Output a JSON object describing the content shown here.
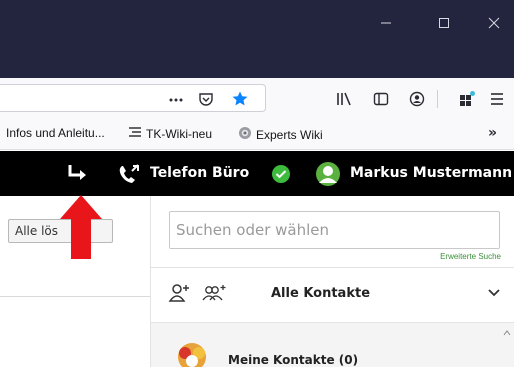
{
  "window": {
    "minimize_label": "—",
    "maximize_label": "□",
    "close_label": "✕"
  },
  "navbar": {
    "url_actions": [
      "page-actions-icon",
      "pocket-icon",
      "bookmark-star-icon"
    ],
    "toolbar_icons": [
      "library-icon",
      "sidebar-icon",
      "account-icon",
      "extension-icon",
      "menu-icon"
    ],
    "more_label": "⋯"
  },
  "bookmarks": {
    "items": [
      {
        "label": "Infos und Anleitu...",
        "icon": "none"
      },
      {
        "label": "TK-Wiki-neu",
        "icon": "wiki-icon"
      },
      {
        "label": "Experts Wiki",
        "icon": "globe-icon"
      }
    ],
    "overflow_label": "»"
  },
  "app_header": {
    "line_label": "Telefon Büro",
    "status": "online",
    "user_name": "Markus Mustermann",
    "colors": {
      "status": "#3dbb3d",
      "avatar": "#5ab13f",
      "background": "#000000"
    }
  },
  "left_panel": {
    "clear_button_label": "Alle lös"
  },
  "right_panel": {
    "search_placeholder": "Suchen oder wählen",
    "advanced_search_label": "Erweiterte Suche",
    "contacts_filter_label": "Alle Kontakte",
    "group_label": "Meine Kontakte (0)"
  },
  "annotation": {
    "arrow_color": "#e8161b"
  }
}
